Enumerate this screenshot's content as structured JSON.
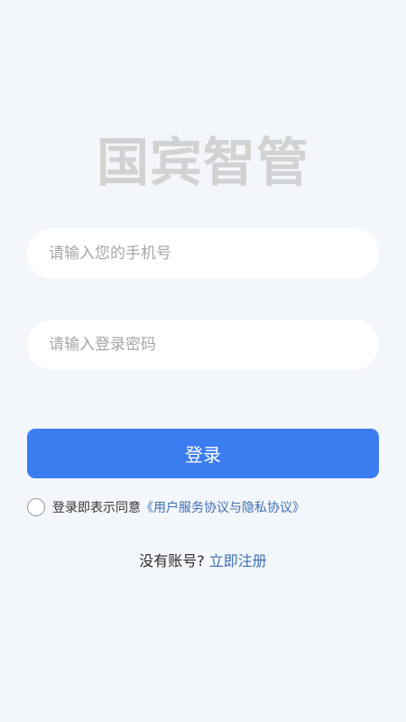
{
  "app": {
    "logo_text": "国宾智管"
  },
  "login_form": {
    "phone_placeholder": "请输入您的手机号",
    "password_placeholder": "请输入登录密码",
    "login_button_label": "登录"
  },
  "agreement": {
    "checked": false,
    "prefix_text": "登录即表示同意",
    "link_text": "《用户服务协议与隐私协议》"
  },
  "register": {
    "prompt_text": "没有账号?",
    "link_text": "立即注册"
  },
  "colors": {
    "background": "#f3f6fa",
    "primary": "#3b7cf0",
    "link": "#3d6fb3",
    "logo": "#d2d2d2"
  }
}
